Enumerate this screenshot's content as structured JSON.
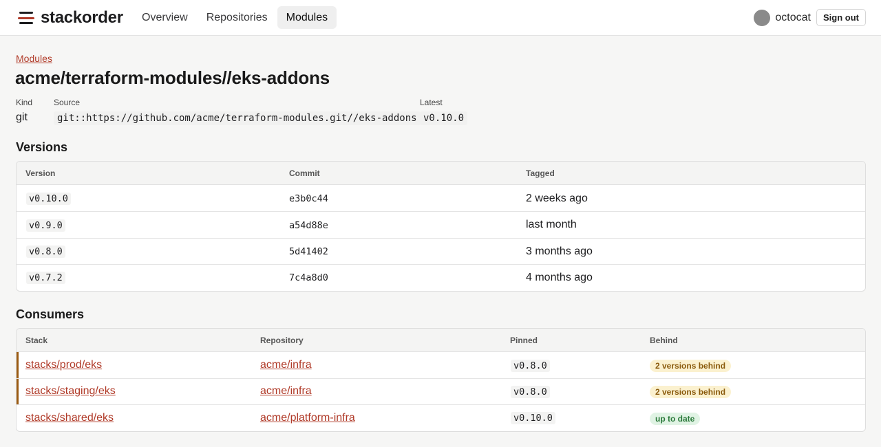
{
  "app": {
    "name": "stackorder"
  },
  "nav": {
    "items": [
      "Overview",
      "Repositories",
      "Modules"
    ],
    "active_index": 2
  },
  "user": {
    "name": "octocat",
    "signout_label": "Sign out"
  },
  "breadcrumb": {
    "label": "Modules"
  },
  "title": "acme/terraform-modules//eks-addons",
  "meta": {
    "kind_label": "Kind",
    "kind_value": "git",
    "source_label": "Source",
    "source_value": "git::https://github.com/acme/terraform-modules.git//eks-addons",
    "latest_label": "Latest",
    "latest_value": "v0.10.0"
  },
  "versions": {
    "title": "Versions",
    "headers": [
      "Version",
      "Commit",
      "Tagged"
    ],
    "rows": [
      {
        "version": "v0.10.0",
        "commit": "e3b0c44",
        "tagged": "2 weeks ago"
      },
      {
        "version": "v0.9.0",
        "commit": "a54d88e",
        "tagged": "last month"
      },
      {
        "version": "v0.8.0",
        "commit": "5d41402",
        "tagged": "3 months ago"
      },
      {
        "version": "v0.7.2",
        "commit": "7c4a8d0",
        "tagged": "4 months ago"
      }
    ]
  },
  "consumers": {
    "title": "Consumers",
    "headers": [
      "Stack",
      "Repository",
      "Pinned",
      "Behind"
    ],
    "rows": [
      {
        "stack": "stacks/prod/eks",
        "repo": "acme/infra",
        "pinned": "v0.8.0",
        "behind": "2 versions behind",
        "status": "warn"
      },
      {
        "stack": "stacks/staging/eks",
        "repo": "acme/infra",
        "pinned": "v0.8.0",
        "behind": "2 versions behind",
        "status": "warn"
      },
      {
        "stack": "stacks/shared/eks",
        "repo": "acme/platform-infra",
        "pinned": "v0.10.0",
        "behind": "up to date",
        "status": "ok"
      }
    ]
  },
  "colors": {
    "accent": "#b03a28",
    "warn_bar": "#9a5a12"
  }
}
